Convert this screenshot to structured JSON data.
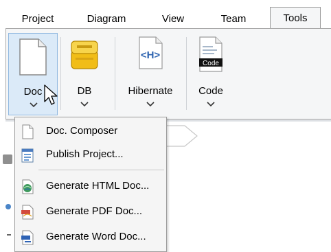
{
  "tabs": [
    {
      "label": "Project"
    },
    {
      "label": "Diagram"
    },
    {
      "label": "View"
    },
    {
      "label": "Team"
    },
    {
      "label": "Tools",
      "active": true
    }
  ],
  "ribbon": {
    "buttons": [
      {
        "label": "Doc",
        "icon": "document-icon",
        "selected": true
      },
      {
        "label": "DB",
        "icon": "database-icon"
      },
      {
        "label": "Hibernate",
        "icon": "hibernate-icon",
        "icon_text": "<H>"
      },
      {
        "label": "Code",
        "icon": "code-icon",
        "icon_text": "Code"
      }
    ]
  },
  "menu": {
    "items": [
      {
        "label": "Doc. Composer",
        "icon": "blank-document-icon"
      },
      {
        "label": "Publish Project...",
        "icon": "publish-project-icon"
      },
      {
        "label": "Generate HTML Doc...",
        "icon": "html-document-icon"
      },
      {
        "label": "Generate PDF Doc...",
        "icon": "pdf-document-icon"
      },
      {
        "label": "Generate Word Doc...",
        "icon": "word-document-icon"
      }
    ]
  },
  "colors": {
    "selected_bg": "#dbeaf8",
    "selected_border": "#8fb7e0",
    "ribbon_bg": "#f5f6f7",
    "menu_bg": "#f5f5f5"
  }
}
